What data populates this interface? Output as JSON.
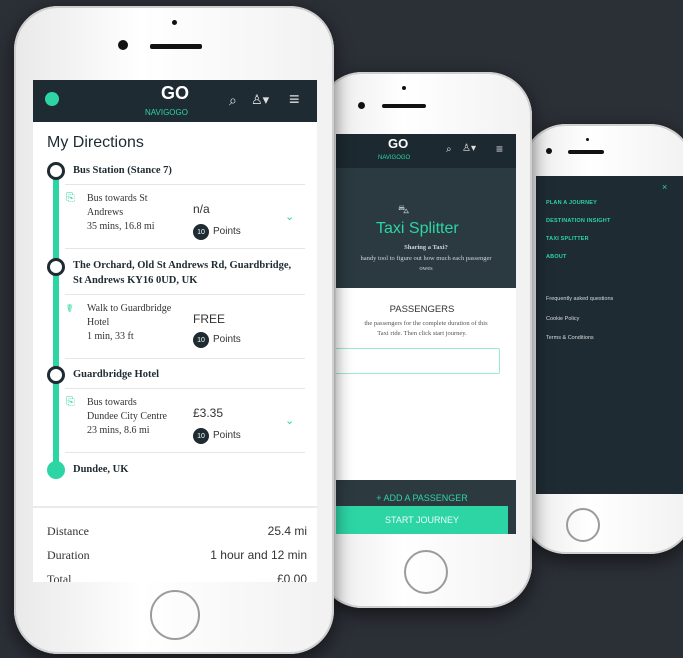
{
  "app": {
    "logo_text": "NAVIGOGO",
    "logo_mark": "GO"
  },
  "directions": {
    "title": "My Directions",
    "stops": [
      "Bus Station (Stance 7)",
      "The Orchard, Old St Andrews Rd, Guardbridge,",
      "St Andrews KY16 0UD, UK",
      "Guardbridge Hotel",
      "Dundee, UK"
    ],
    "legs": [
      {
        "line1": "Bus towards St",
        "line2": "Andrews",
        "line3": "35 mins, 16.8 mi",
        "price": "n/a",
        "points": "10",
        "points_label": "Points"
      },
      {
        "line1": "Walk to Guardbridge",
        "line2": "Hotel",
        "line3": "1 min, 33 ft",
        "price": "FREE",
        "points": "10",
        "points_label": "Points"
      },
      {
        "line1": "Bus towards",
        "line2": "Dundee City Centre",
        "line3": "23 mins, 8.6 mi",
        "price": "£3.35",
        "points": "10",
        "points_label": "Points"
      }
    ],
    "summary": {
      "distance_label": "Distance",
      "distance_value": "25.4 mi",
      "duration_label": "Duration",
      "duration_value": "1 hour and 12 min",
      "total_label": "Total",
      "total_value": "£0.00"
    }
  },
  "taxi": {
    "title": "Taxi Splitter",
    "question": "Sharing a Taxi?",
    "desc1": "handy tool to figure out how much each passenger",
    "desc2": "owes",
    "passengers_heading": "PASSENGERS",
    "instr1": "the passengers for the complete duration of this",
    "instr2": "Taxi ride. Then click start journey.",
    "add_label": "+ ADD A PASSENGER",
    "start_label": "START JOURNEY"
  },
  "menu": {
    "primary": [
      "PLAN A JOURNEY",
      "DESTINATION INSIGHT",
      "TAXI SPLITTER",
      "ABOUT"
    ],
    "secondary": [
      "Frequently asked questions",
      "Cookie Policy",
      "Terms & Conditions"
    ],
    "close": "×"
  },
  "colors": {
    "accent": "#2dd4a4",
    "dark": "#1e2b32",
    "background": "#2b2f36"
  }
}
